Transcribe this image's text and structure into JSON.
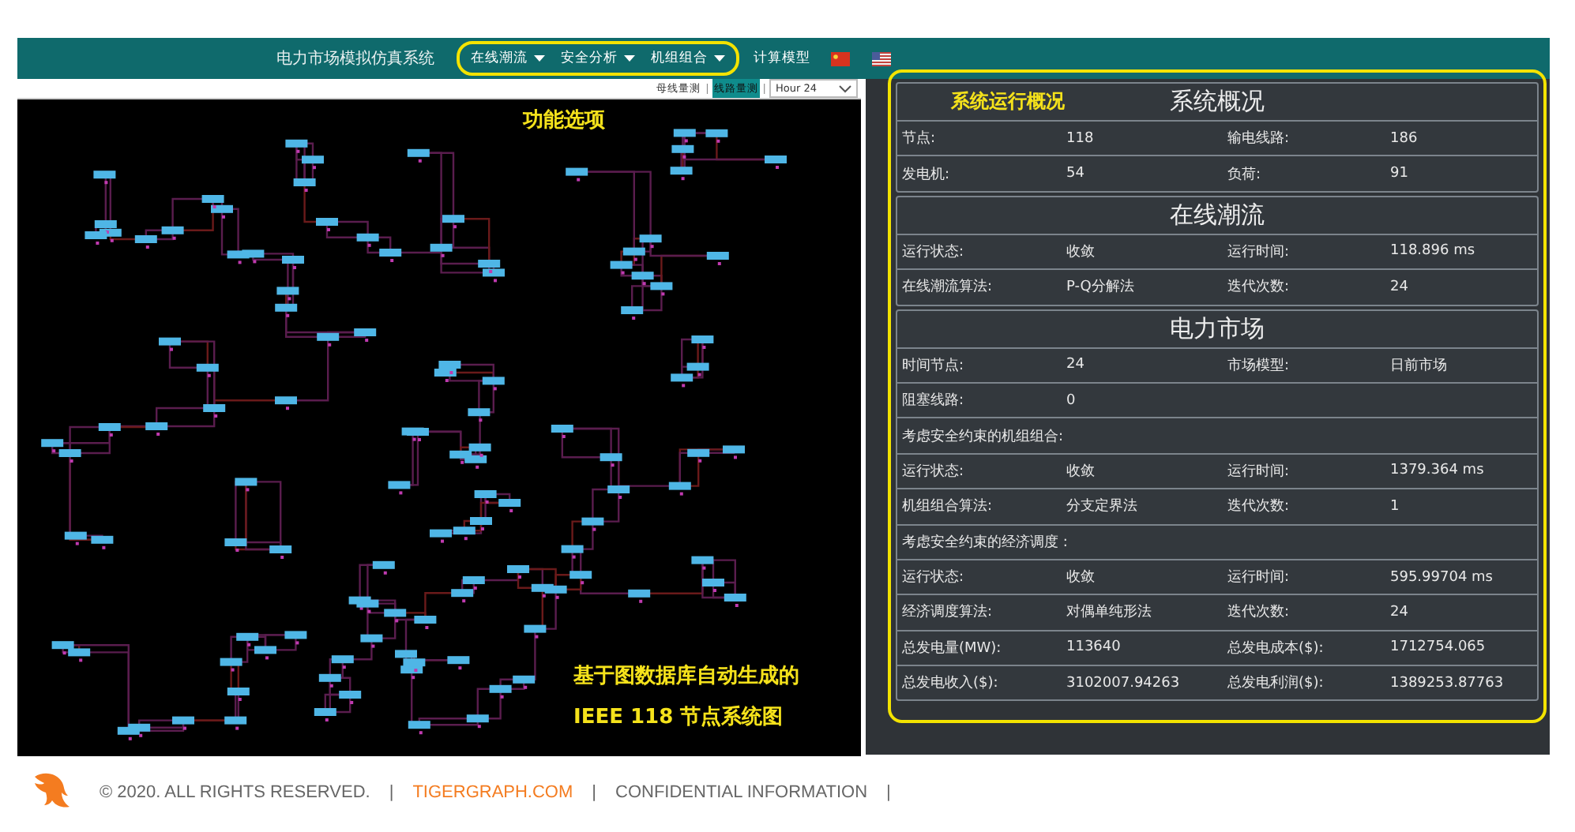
{
  "header": {
    "title": "电力市场模拟仿真系统",
    "menu": [
      {
        "label": "在线潮流",
        "dropdown": true
      },
      {
        "label": "安全分析",
        "dropdown": true
      },
      {
        "label": "机组组合",
        "dropdown": true
      },
      {
        "label": "计算模型",
        "dropdown": false
      }
    ],
    "languages": [
      {
        "kind": "cn"
      },
      {
        "kind": "us"
      }
    ]
  },
  "toolbar": {
    "items": [
      {
        "kind": "toggle",
        "label": "母线量测",
        "selected": false
      },
      {
        "kind": "separator",
        "label": "|"
      },
      {
        "kind": "toggle",
        "label": "线路量测",
        "selected": true
      },
      {
        "kind": "separator",
        "label": "|"
      }
    ],
    "hour_select": {
      "value": "Hour 24"
    }
  },
  "annotations": {
    "menu_note": "功能选项",
    "panel_note": "系统运行概况",
    "diagram_note": [
      "基于图数据库自动生成的",
      "IEEE 118 节点系统图"
    ]
  },
  "sections": [
    {
      "title": "系统概况",
      "rows": [
        {
          "cells": [
            "节点:",
            "118",
            "输电线路:",
            "186"
          ]
        },
        {
          "cells": [
            "发电机:",
            "54",
            "负荷:",
            "91"
          ]
        }
      ]
    },
    {
      "title": "在线潮流",
      "rows": [
        {
          "cells": [
            "运行状态:",
            "收敛",
            "运行时间:",
            "118.896 ms"
          ]
        },
        {
          "cells": [
            "在线潮流算法:",
            "P-Q分解法",
            "迭代次数:",
            "24"
          ]
        }
      ]
    },
    {
      "title": "电力市场",
      "rows": [
        {
          "cells": [
            "时间节点:",
            "24",
            "市场模型:",
            "日前市场"
          ]
        },
        {
          "cells": [
            "阻塞线路:",
            "0"
          ]
        },
        {
          "cells": [
            "考虑安全约束的机组组合:"
          ]
        },
        {
          "cells": [
            "运行状态:",
            "收敛",
            "运行时间:",
            "1379.364 ms"
          ]
        },
        {
          "cells": [
            "机组组合算法:",
            "分支定界法",
            "迭代次数:",
            "1"
          ]
        },
        {
          "cells": [
            "考虑安全约束的经济调度 :"
          ]
        },
        {
          "cells": [
            "运行状态:",
            "收敛",
            "运行时间:",
            "595.99704 ms"
          ]
        },
        {
          "cells": [
            "经济调度算法:",
            "对偶单纯形法",
            "迭代次数:",
            "24"
          ]
        },
        {
          "cells": [
            "总发电量(MW):",
            "113640",
            "总发电成本($):",
            "1712754.065"
          ]
        },
        {
          "cells": [
            "总发电收入($):",
            "3102007.94263",
            "总发电利润($):",
            "1389253.87763"
          ]
        }
      ]
    }
  ],
  "footer": {
    "items": [
      {
        "kind": "text",
        "text": "© 2020. ALL RIGHTS RESERVED."
      },
      {
        "kind": "separator",
        "text": "|"
      },
      {
        "kind": "link",
        "text": "TIGERGRAPH.COM"
      },
      {
        "kind": "separator",
        "text": "|"
      },
      {
        "kind": "text",
        "text": "CONFIDENTIAL INFORMATION"
      },
      {
        "kind": "separator",
        "text": "|"
      }
    ]
  }
}
